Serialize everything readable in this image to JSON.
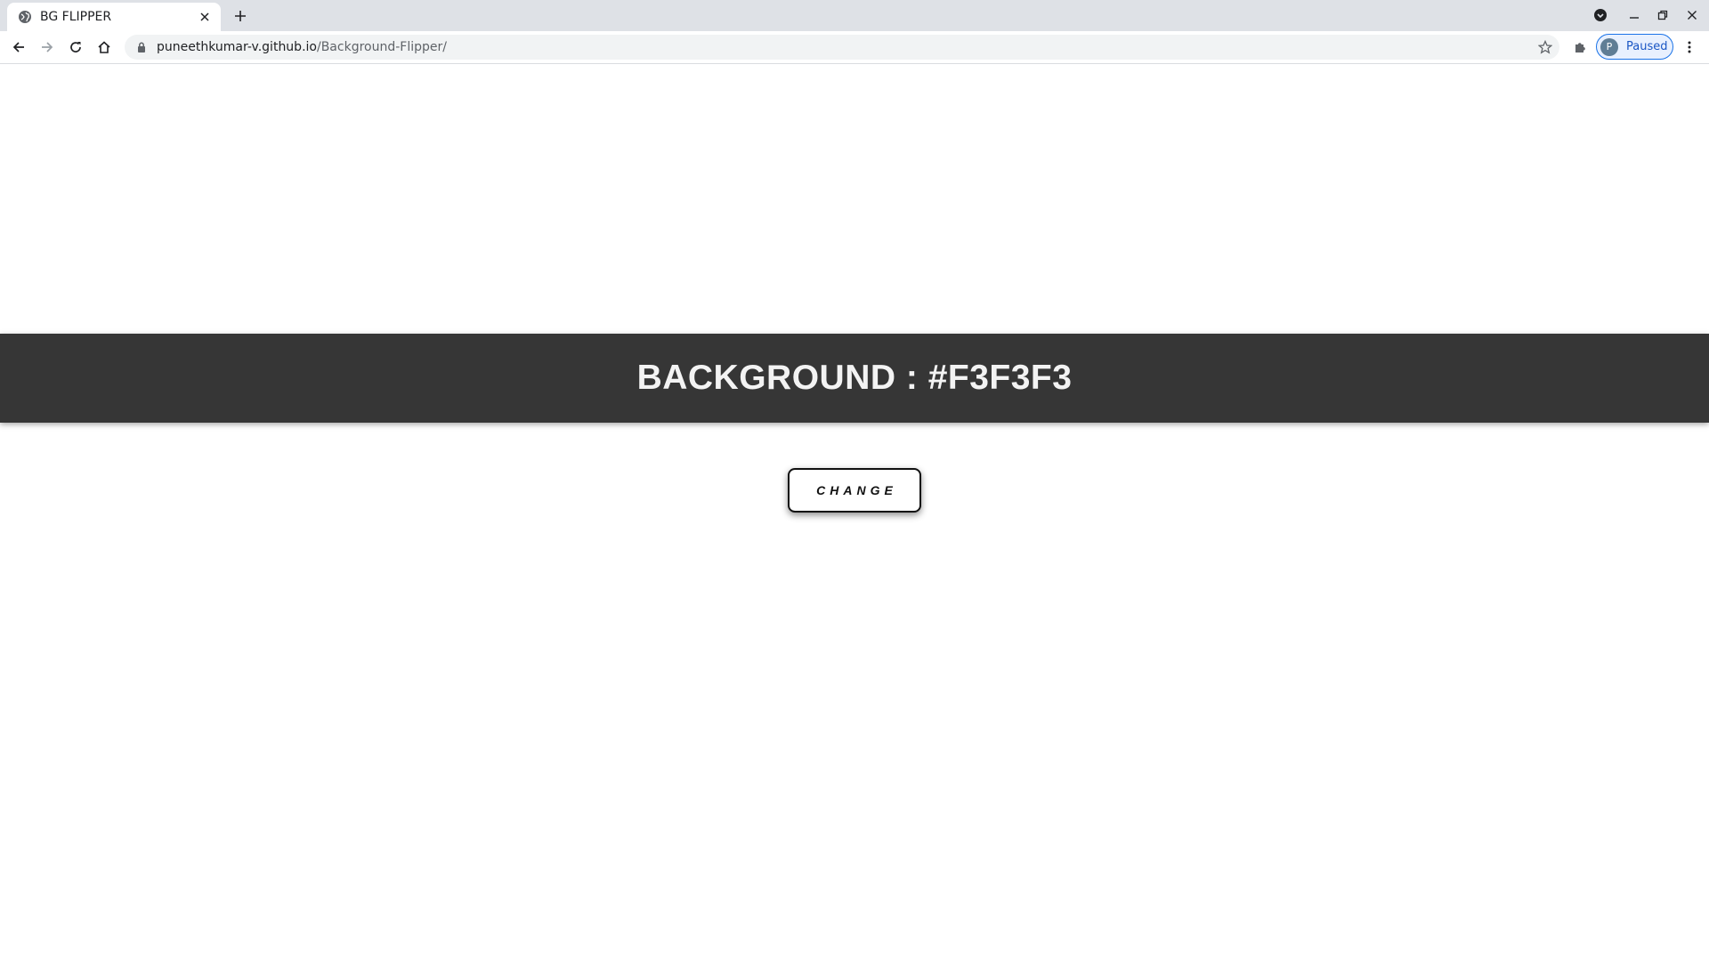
{
  "browser": {
    "tab": {
      "title": "BG FLIPPER",
      "favicon": "globe-icon"
    },
    "url": {
      "host": "puneethkumar-v.github.io",
      "path": "/Background-Flipper/"
    },
    "profile": {
      "initial": "P",
      "status": "Paused"
    }
  },
  "page": {
    "heading": "BACKGROUND : #F3F3F3",
    "button_label": "CHANGE",
    "colors": {
      "banner": "#363636",
      "heading_text": "#F3F3F3",
      "page_background": "#FFFFFF"
    }
  }
}
